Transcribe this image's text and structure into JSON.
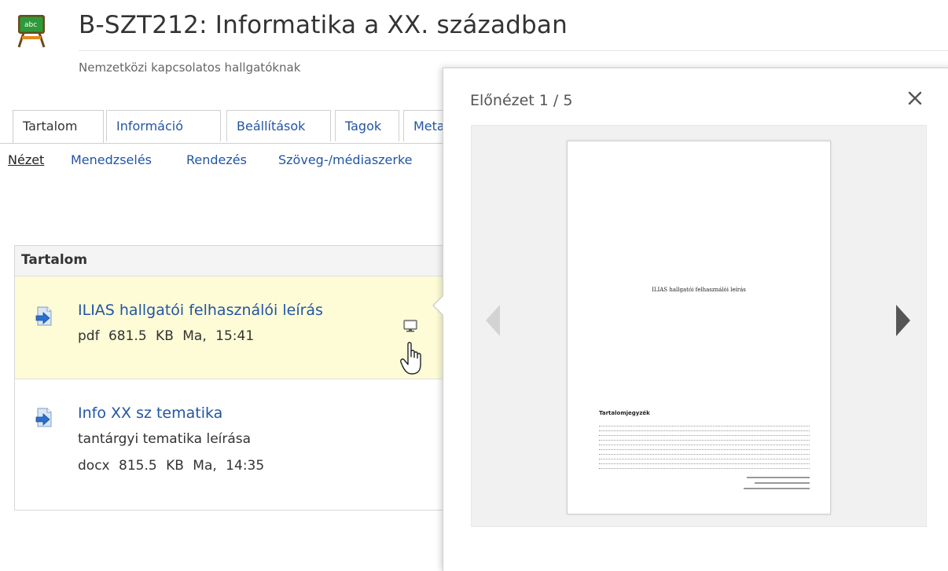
{
  "header": {
    "title": "B-SZT212: Informatika a XX. században",
    "subtitle": "Nemzetközi kapcsolatos hallgatóknak",
    "icon": "chalkboard-icon"
  },
  "tabs": [
    {
      "label": "Tartalom",
      "active": true
    },
    {
      "label": "Információ",
      "active": false
    },
    {
      "label": "Beállítások",
      "active": false
    },
    {
      "label": "Tagok",
      "active": false
    },
    {
      "label": "Meta",
      "active": false
    }
  ],
  "subtabs": [
    {
      "label": "Nézet",
      "active": true
    },
    {
      "label": "Menedzselés",
      "active": false
    },
    {
      "label": "Rendezés",
      "active": false
    },
    {
      "label": "Szöveg-/médiaszerke",
      "active": false
    }
  ],
  "content": {
    "heading": "Tartalom",
    "items": [
      {
        "title": "ILIAS hallgatói felhasználói leírás",
        "meta": "pdf   681.5 KB   Ma, 15:41",
        "icon": "download-file-icon",
        "highlighted": true
      },
      {
        "title": "Info XX sz tematika",
        "description": "tantárgyi tematika leírása",
        "meta": "docx   815.5 KB   Ma, 14:35",
        "icon": "download-file-icon",
        "highlighted": false
      }
    ]
  },
  "preview": {
    "title": "Előnézet 1 / 5",
    "close_icon": "close-icon",
    "prev_icon": "chevron-left-icon",
    "next_icon": "chevron-right-icon",
    "document": {
      "title": "ILIAS hallgatói felhasználói leírás",
      "toc_heading": "Tartalomjegyzék"
    }
  },
  "colors": {
    "link": "#2255a4",
    "highlight": "#fefcd6",
    "tab_border": "#cfcfcf"
  }
}
